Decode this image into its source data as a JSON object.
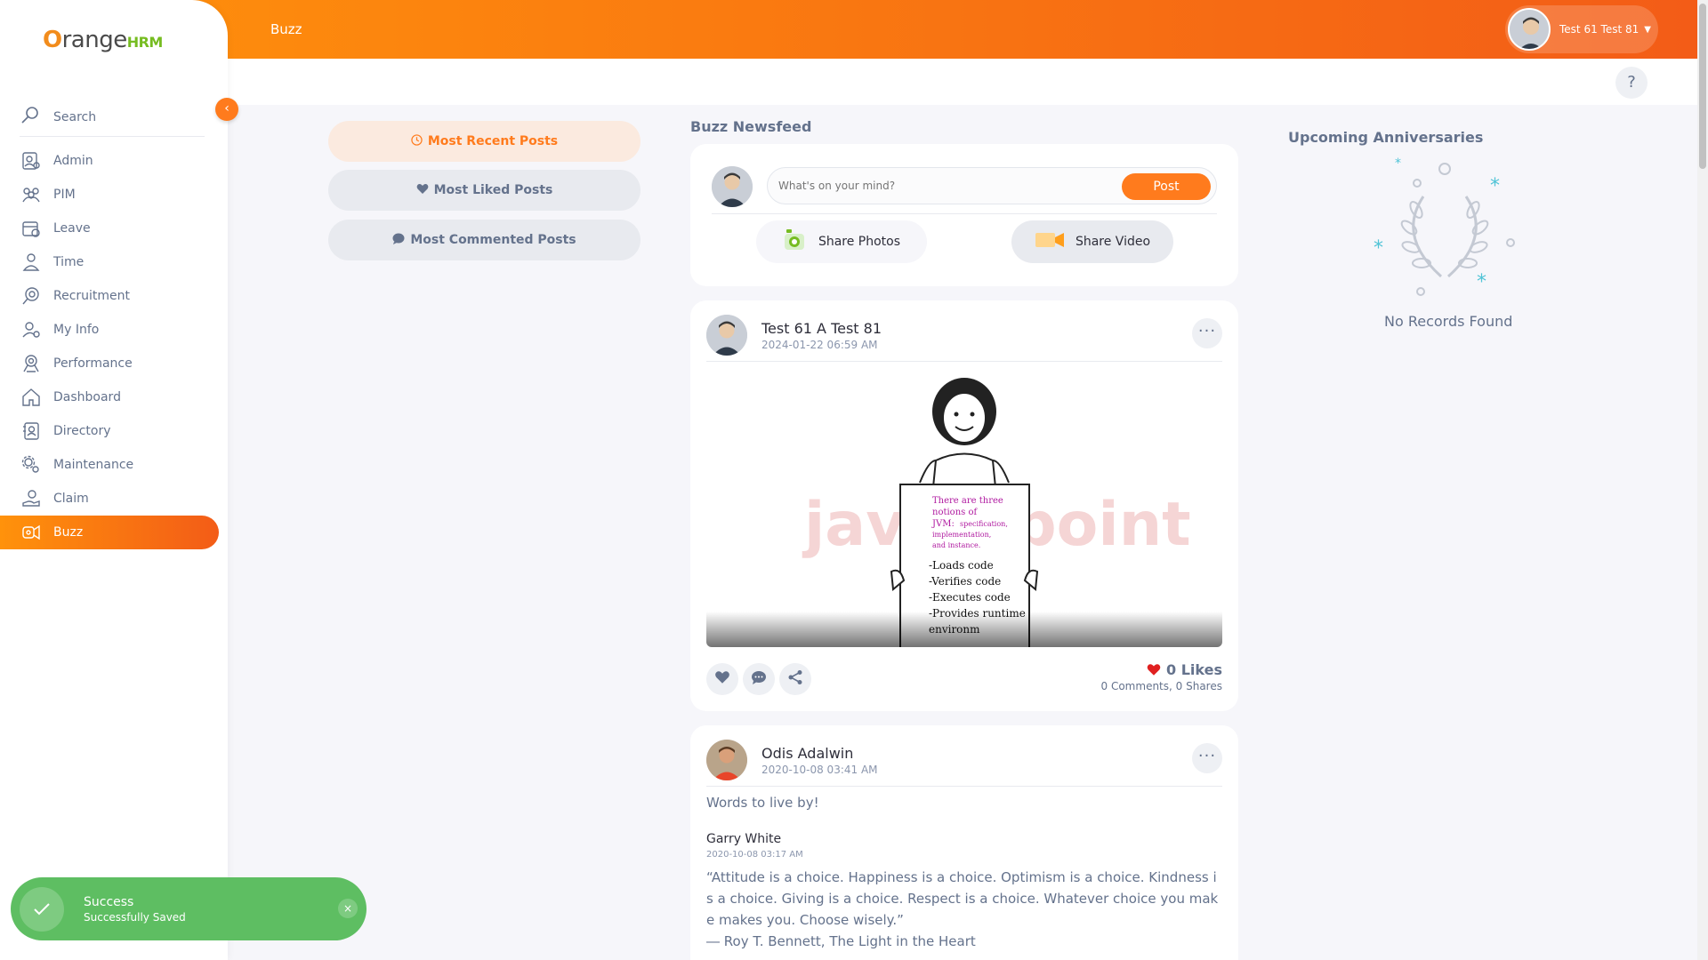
{
  "app": {
    "brand_o": "O",
    "brand_range": "range",
    "brand_hrm": "HRM",
    "page_title": "Buzz",
    "user_name": "Test 61 Test 81",
    "help": "?"
  },
  "sidebar": {
    "search_label": "Search",
    "items": [
      {
        "label": "Admin",
        "icon": "admin-icon"
      },
      {
        "label": "PIM",
        "icon": "pim-icon"
      },
      {
        "label": "Leave",
        "icon": "leave-icon"
      },
      {
        "label": "Time",
        "icon": "time-icon"
      },
      {
        "label": "Recruitment",
        "icon": "recruitment-icon"
      },
      {
        "label": "My Info",
        "icon": "my-info-icon"
      },
      {
        "label": "Performance",
        "icon": "performance-icon"
      },
      {
        "label": "Dashboard",
        "icon": "dashboard-icon"
      },
      {
        "label": "Directory",
        "icon": "directory-icon"
      },
      {
        "label": "Maintenance",
        "icon": "maintenance-icon"
      },
      {
        "label": "Claim",
        "icon": "claim-icon"
      },
      {
        "label": "Buzz",
        "icon": "buzz-icon",
        "active": true
      }
    ]
  },
  "filters": [
    {
      "label": "Most Recent Posts",
      "icon": "clock-icon",
      "active": true
    },
    {
      "label": "Most Liked Posts",
      "icon": "heart-icon"
    },
    {
      "label": "Most Commented Posts",
      "icon": "comment-icon"
    }
  ],
  "feed": {
    "title": "Buzz Newsfeed",
    "composer": {
      "placeholder": "What's on your mind?",
      "post_label": "Post",
      "share_photos": "Share Photos",
      "share_video": "Share Video"
    },
    "posts": [
      {
        "author": "Test 61 A Test 81",
        "date": "2024-01-22 06:59 AM",
        "image_text": {
          "line1": "There are three",
          "line2": "notions of",
          "line3a": "JVM:",
          "line3b": "specification,",
          "line4": "implementation,",
          "line5": "and instance.",
          "list": [
            "-Loads code",
            "-Verifies code",
            "-Executes code",
            "-Provides runtime",
            "environm"
          ]
        },
        "likes": "0 Likes",
        "comments": "0 Comments",
        "shares": "0 Shares"
      },
      {
        "author": "Odis Adalwin",
        "date": "2020-10-08 03:41 AM",
        "text": "Words to live by!",
        "original_author": "Garry  White",
        "original_date": "2020-10-08 03:17 AM",
        "quote": "“Attitude is a choice. Happiness is a choice. Optimism is a choice. Kindness is a choice. Giving is a choice. Respect is a choice. Whatever choice you make makes you. Choose wisely.”",
        "quote_source": "― Roy T. Bennett, The Light in the Heart"
      }
    ]
  },
  "anniversaries": {
    "title": "Upcoming Anniversaries",
    "empty": "No Records Found"
  },
  "toast": {
    "title": "Success",
    "message": "Successfully Saved",
    "close": "×"
  },
  "colors": {
    "accent": "#ff7b1d",
    "success": "#5ebe62",
    "text": "#64728c"
  }
}
